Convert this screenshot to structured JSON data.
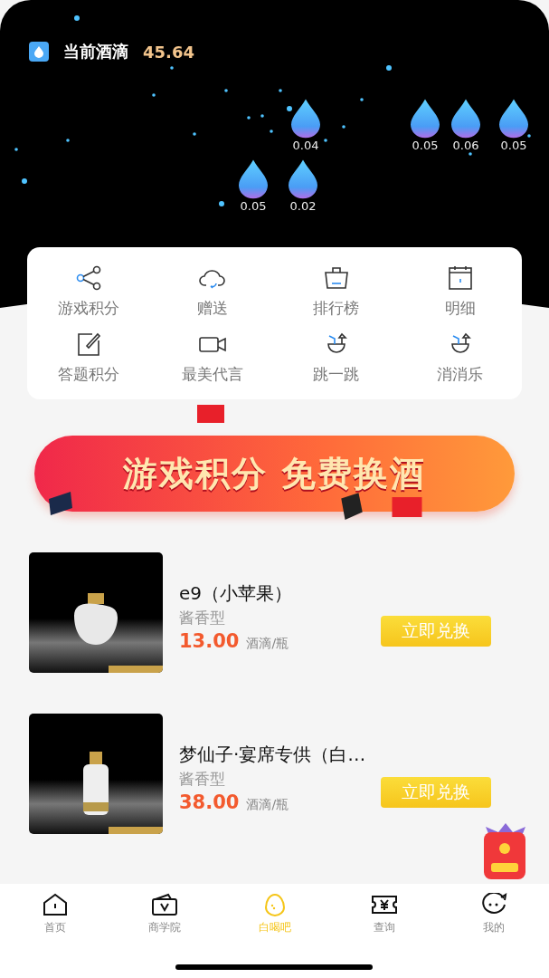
{
  "header": {
    "label": "当前酒滴",
    "balance": "45.64"
  },
  "drops": [
    {
      "value": "0.04"
    },
    {
      "value": "0.05"
    },
    {
      "value": "0.06"
    },
    {
      "value": "0.05"
    },
    {
      "value": "0.05"
    },
    {
      "value": "0.02"
    }
  ],
  "menu": [
    {
      "label": "游戏积分",
      "kind": "share"
    },
    {
      "label": "赠送",
      "kind": "cloud"
    },
    {
      "label": "排行榜",
      "kind": "basket"
    },
    {
      "label": "明细",
      "kind": "calendar"
    },
    {
      "label": "答题积分",
      "kind": "edit"
    },
    {
      "label": "最美代言",
      "kind": "video"
    },
    {
      "label": "跳一跳",
      "kind": "coconut"
    },
    {
      "label": "消消乐",
      "kind": "coconut"
    }
  ],
  "banner": {
    "text": "游戏积分 免费换酒"
  },
  "products": [
    {
      "name": "e9（小苹果）",
      "type": "酱香型",
      "price": "13.00",
      "unit": "酒滴/瓶",
      "action": "立即兑换"
    },
    {
      "name": "梦仙子·宴席专供（白…",
      "type": "酱香型",
      "price": "38.00",
      "unit": "酒滴/瓶",
      "action": "立即兑换"
    }
  ],
  "tabs": [
    {
      "label": "首页",
      "selected": false
    },
    {
      "label": "商学院",
      "selected": false
    },
    {
      "label": "白喝吧",
      "selected": true
    },
    {
      "label": "查询",
      "selected": false
    },
    {
      "label": "我的",
      "selected": false
    }
  ]
}
